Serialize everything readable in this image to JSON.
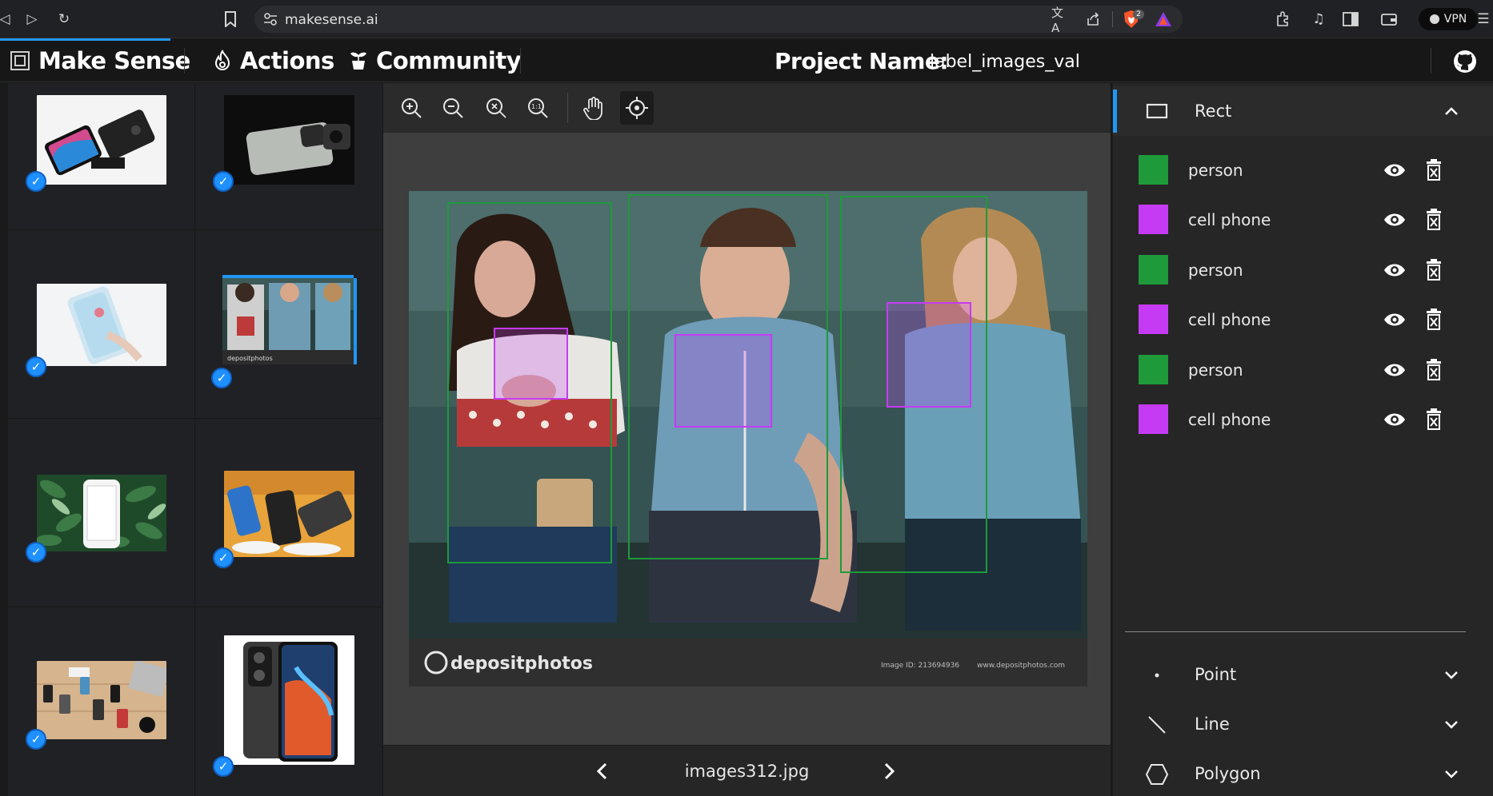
{
  "browser": {
    "url": "makesense.ai",
    "vpn_label": "VPN",
    "brave_badge": "2"
  },
  "nav": {
    "app_title": "Make Sense",
    "actions_label": "Actions",
    "community_label": "Community",
    "project_label": "Project Name:",
    "project_name": "label_images_val"
  },
  "image_list": {
    "thumbnails": [
      {
        "name": "flip-phone",
        "checked": true,
        "active": false
      },
      {
        "name": "xiaomi-phone",
        "checked": true,
        "active": false
      },
      {
        "name": "white-phone",
        "checked": true,
        "active": false
      },
      {
        "name": "three-people-phones",
        "checked": true,
        "active": true
      },
      {
        "name": "phone-leaves",
        "checked": true,
        "active": false
      },
      {
        "name": "iphones-orange",
        "checked": true,
        "active": false
      },
      {
        "name": "desk-phones",
        "checked": true,
        "active": false
      },
      {
        "name": "poco-phone",
        "checked": true,
        "active": false
      }
    ]
  },
  "editor": {
    "toolbar": [
      "zoom-in",
      "zoom-out",
      "zoom-fit",
      "zoom-actual",
      "pan",
      "crosshair"
    ],
    "filename": "images312.jpg",
    "watermark_brand": "depositphotos",
    "watermark_id": "Image ID: 213694936",
    "watermark_url": "www.depositphotos.com"
  },
  "labels_panel": {
    "active_tool": "Rect",
    "labels": [
      {
        "name": "person",
        "color": "#1e9a3a"
      },
      {
        "name": "cell phone",
        "color": "#c53bf4"
      },
      {
        "name": "person",
        "color": "#1e9a3a"
      },
      {
        "name": "cell phone",
        "color": "#c53bf4"
      },
      {
        "name": "person",
        "color": "#1e9a3a"
      },
      {
        "name": "cell phone",
        "color": "#c53bf4"
      }
    ],
    "other_tools": [
      {
        "name": "Point"
      },
      {
        "name": "Line"
      },
      {
        "name": "Polygon"
      }
    ]
  },
  "colors": {
    "accent": "#2196f3",
    "person": "#1e9a3a",
    "cell_phone": "#c53bf4"
  }
}
